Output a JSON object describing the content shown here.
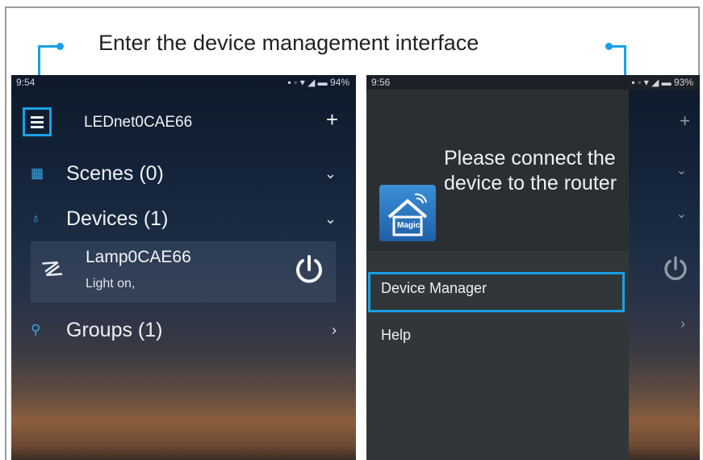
{
  "caption": "Enter the device management interface",
  "accent_color": "#1aa0e6",
  "phone1": {
    "status_time": "9:54",
    "status_battery": "94%",
    "menu_icon": "hamburger-menu-icon",
    "title": "LEDnet0CAE66",
    "add_label": "+",
    "scenes_label": "Scenes (0)",
    "devices_label": "Devices (1)",
    "lamp_name": "Lamp0CAE66",
    "lamp_status": "Light on,",
    "groups_label": "Groups (1)"
  },
  "phone2": {
    "status_time": "9:56",
    "status_battery": "93%",
    "connect_message": "Please connect the device to the router",
    "app_icon_text": "Magic",
    "menu": [
      "Device Manager",
      "Help"
    ]
  }
}
